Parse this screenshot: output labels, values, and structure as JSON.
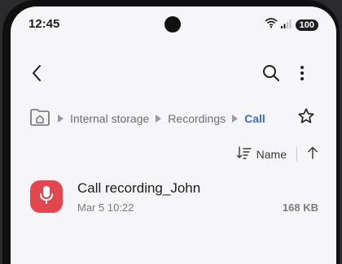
{
  "status_bar": {
    "time": "12:45",
    "battery": "100"
  },
  "app_bar": {
    "back_icon": "chevron-left-icon",
    "search_icon": "search-icon",
    "more_icon": "more-vert-icon"
  },
  "breadcrumb": {
    "home_icon": "home-folder-icon",
    "items": [
      "Internal storage",
      "Recordings",
      "Call"
    ],
    "favorite_icon": "star-outline-icon"
  },
  "sort": {
    "label": "Name",
    "sort_icon": "sort-lines-icon",
    "direction_icon": "arrow-up-icon"
  },
  "files": [
    {
      "name": "Call recording_John",
      "date": "Mar 5 10:22",
      "size": "168 KB",
      "icon": "microphone-icon",
      "icon_color": "#e2474f"
    }
  ],
  "colors": {
    "accent": "#3a6ec9",
    "background": "#f6f6f8"
  }
}
